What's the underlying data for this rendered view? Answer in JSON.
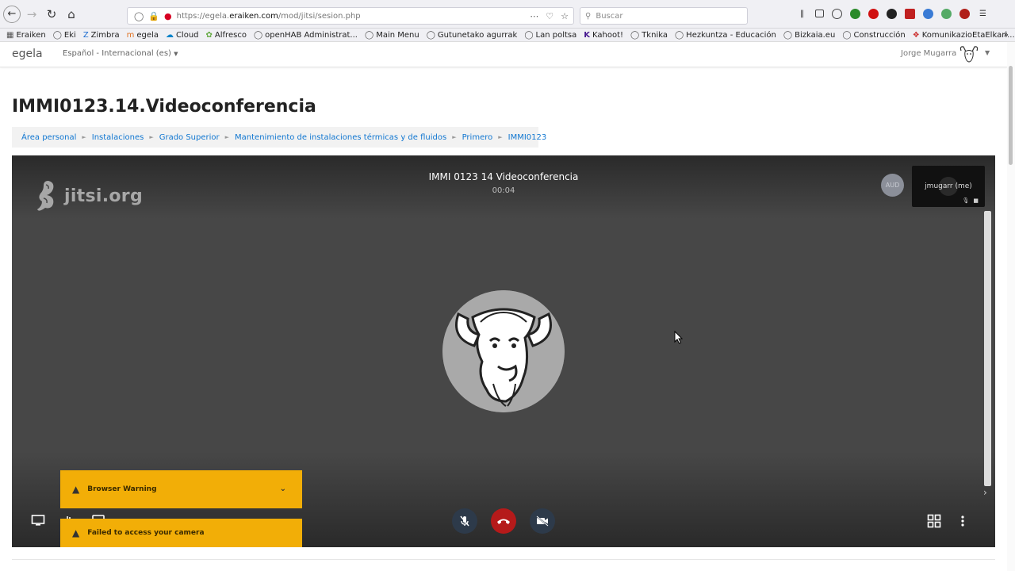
{
  "browser": {
    "url_prefix": "https://egela.",
    "url_domain": "eraiken.com",
    "url_path": "/mod/jitsi/sesion.php",
    "search_placeholder": "Buscar"
  },
  "bookmarks": [
    {
      "label": "Eraiken"
    },
    {
      "label": "Eki"
    },
    {
      "label": "Zimbra"
    },
    {
      "label": "egela"
    },
    {
      "label": "Cloud"
    },
    {
      "label": "Alfresco"
    },
    {
      "label": "openHAB Administrat..."
    },
    {
      "label": "Main Menu"
    },
    {
      "label": "Gutunetako agurrak"
    },
    {
      "label": "Lan poltsa"
    },
    {
      "label": "Kahoot!"
    },
    {
      "label": "Tknika"
    },
    {
      "label": "Hezkuntza - Educación"
    },
    {
      "label": "Bizkaia.eu"
    },
    {
      "label": "Construcción"
    },
    {
      "label": "KomunikazioEtaElkarl..."
    }
  ],
  "moodle": {
    "brand": "egela",
    "language": "Español - Internacional (es)",
    "user_name": "Jorge Mugarra"
  },
  "page": {
    "title": "IMMI0123.14.Videoconferencia",
    "breadcrumb": [
      "Área personal",
      "Instalaciones",
      "Grado Superior",
      "Mantenimiento de instalaciones térmicas y de fluidos",
      "Primero",
      "IMMI0123"
    ]
  },
  "jitsi": {
    "logo_text": "jitsi.org",
    "conference_title": "IMMI 0123 14 Videoconferencia",
    "timer": "00:04",
    "aud_badge": "AUD",
    "self_name": "jmugarr (me)",
    "warnings": [
      {
        "text": "Browser Warning"
      },
      {
        "text": "Failed to access your camera"
      }
    ]
  }
}
